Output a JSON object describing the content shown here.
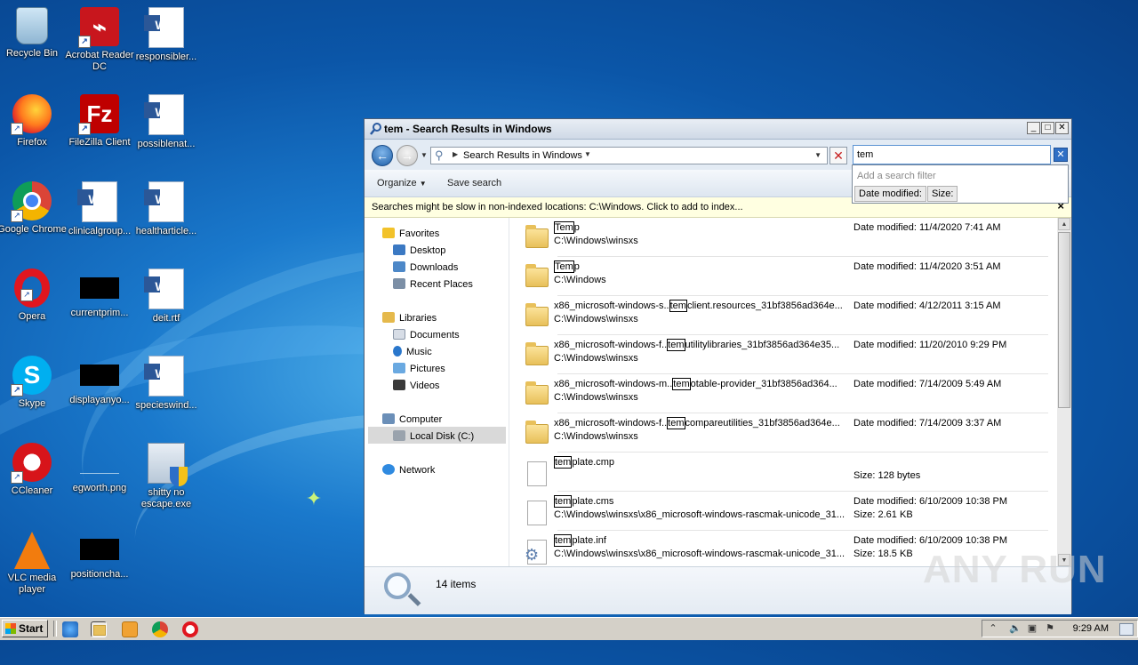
{
  "desktop": {
    "icons": [
      {
        "label": "Recycle Bin",
        "icon": "recycle-bin-icon"
      },
      {
        "label": "Acrobat Reader DC",
        "icon": "acrobat-icon"
      },
      {
        "label": "responsibler...",
        "icon": "word-document-icon"
      },
      {
        "label": "Firefox",
        "icon": "firefox-icon"
      },
      {
        "label": "FileZilla Client",
        "icon": "filezilla-icon"
      },
      {
        "label": "possiblenat...",
        "icon": "word-document-icon"
      },
      {
        "label": "Google Chrome",
        "icon": "chrome-icon"
      },
      {
        "label": "clinicalgroup...",
        "icon": "word-document-icon"
      },
      {
        "label": "healtharticle...",
        "icon": "word-document-icon"
      },
      {
        "label": "Opera",
        "icon": "opera-icon"
      },
      {
        "label": "currentprim...",
        "icon": "black-thumbnail-icon"
      },
      {
        "label": "deit.rtf",
        "icon": "word-document-icon"
      },
      {
        "label": "Skype",
        "icon": "skype-icon"
      },
      {
        "label": "displayanyo...",
        "icon": "black-thumbnail-icon"
      },
      {
        "label": "specieswind...",
        "icon": "word-document-icon"
      },
      {
        "label": "CCleaner",
        "icon": "ccleaner-icon"
      },
      {
        "label": "egworth.png",
        "icon": "png-thumbnail-icon"
      },
      {
        "label": "shitty no escape.exe",
        "icon": "exe-icon"
      },
      {
        "label": "VLC media player",
        "icon": "vlc-icon"
      },
      {
        "label": "positioncha...",
        "icon": "black-thumbnail-icon"
      }
    ]
  },
  "window": {
    "title": "tem - Search Results in Windows",
    "minimize": "_",
    "maximize": "□",
    "close": "✕",
    "address": "Search Results in Windows",
    "search_value": "tem",
    "filter_hint": "Add a search filter",
    "filter_date": "Date modified:",
    "filter_size": "Size:",
    "toolbar": {
      "organize": "Organize",
      "save_search": "Save search"
    },
    "infobar": "Searches might be slow in non-indexed locations: C:\\Windows. Click to add to index...",
    "item_count": "14 items"
  },
  "nav": {
    "favorites": "Favorites",
    "desktop": "Desktop",
    "downloads": "Downloads",
    "recent": "Recent Places",
    "libraries": "Libraries",
    "documents": "Documents",
    "music": "Music",
    "pictures": "Pictures",
    "videos": "Videos",
    "computer": "Computer",
    "local_disk": "Local Disk (C:)",
    "network": "Network"
  },
  "results": [
    {
      "type": "folder",
      "match": "Tem",
      "rest": "p",
      "path": "C:\\Windows\\winsxs",
      "date": "Date modified: 11/4/2020 7:41 AM",
      "size": ""
    },
    {
      "type": "folder",
      "match": "Tem",
      "rest": "p",
      "path": "C:\\Windows",
      "date": "Date modified: 11/4/2020 3:51 AM",
      "size": ""
    },
    {
      "type": "folder",
      "pre": "x86_microsoft-windows-s..",
      "match": "tem",
      "rest": "client.resources_31bf3856ad364e...",
      "path": "C:\\Windows\\winsxs",
      "date": "Date modified: 4/12/2011 3:15 AM",
      "size": ""
    },
    {
      "type": "folder",
      "pre": "x86_microsoft-windows-f..",
      "match": "tem",
      "rest": "utilitylibraries_31bf3856ad364e35...",
      "path": "C:\\Windows\\winsxs",
      "date": "Date modified: 11/20/2010 9:29 PM",
      "size": ""
    },
    {
      "type": "folder",
      "pre": "x86_microsoft-windows-m..",
      "match": "tem",
      "rest": "otable-provider_31bf3856ad364...",
      "path": "C:\\Windows\\winsxs",
      "date": "Date modified: 7/14/2009 5:49 AM",
      "size": ""
    },
    {
      "type": "folder",
      "pre": "x86_microsoft-windows-f..",
      "match": "tem",
      "rest": "compareutilities_31bf3856ad364e...",
      "path": "C:\\Windows\\winsxs",
      "date": "Date modified: 7/14/2009 3:37 AM",
      "size": ""
    },
    {
      "type": "file",
      "match": "tem",
      "rest": "plate.cmp",
      "path": "",
      "date": "",
      "size": "Size: 128 bytes"
    },
    {
      "type": "file",
      "match": "tem",
      "rest": "plate.cms",
      "path": "C:\\Windows\\winsxs\\x86_microsoft-windows-rascmak-unicode_31...",
      "date": "Date modified: 6/10/2009 10:38 PM",
      "size": "Size: 2.61 KB"
    },
    {
      "type": "gear",
      "match": "tem",
      "rest": "plate.inf",
      "path": "C:\\Windows\\winsxs\\x86_microsoft-windows-rascmak-unicode_31...",
      "date": "Date modified: 6/10/2009 10:38 PM",
      "size": "Size: 18.5 KB"
    }
  ],
  "taskbar": {
    "start": "Start",
    "clock": "9:29 AM"
  },
  "watermark": "ANY RUN"
}
